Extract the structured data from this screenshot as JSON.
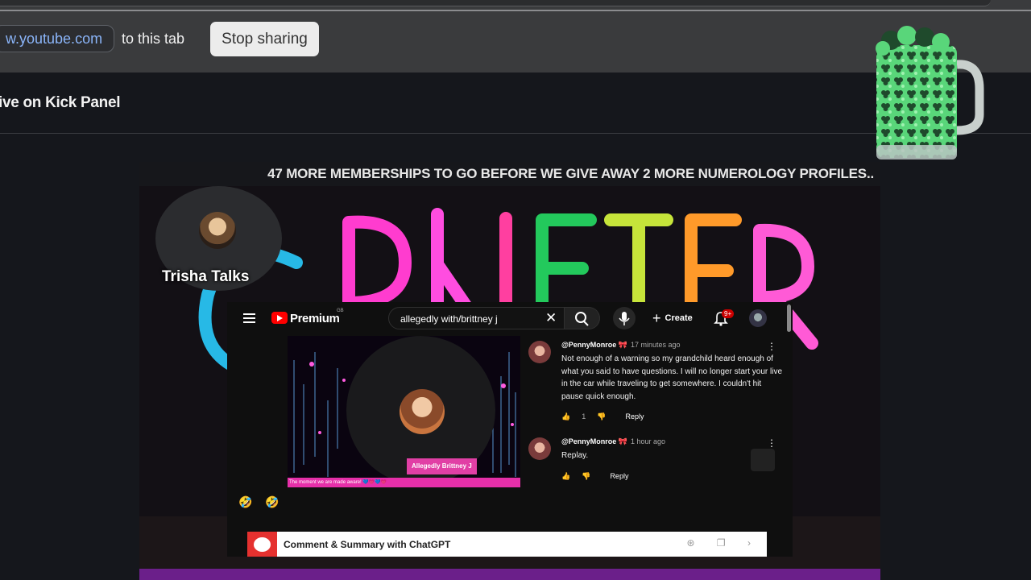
{
  "share_bar": {
    "url": "w.youtube.com",
    "sharing_text": "to this tab",
    "stop_label": "Stop sharing"
  },
  "panel": {
    "title": "ive on Kick Panel"
  },
  "stream": {
    "banner": "47 MORE MEMBERSHIPS TO GO BEFORE WE GIVE AWAY 2 MORE NUMEROLOGY PROFILES..",
    "host_name": "Trisha Talks"
  },
  "youtube": {
    "brand": "Premium",
    "country": "GB",
    "search_value": "allegedly with/brittney j",
    "create_label": "Create",
    "notification_count": "9+",
    "video": {
      "name_tag": "Allegedly Brittney J",
      "ticker": "The moment we are made aware! 💙💗💙💗"
    },
    "emojis": "🤣 🤣",
    "chatgpt_bar": "Comment & Summary with ChatGPT",
    "comments": [
      {
        "author": "@PennyMonroe",
        "time": "17 minutes ago",
        "text": "Not enough of a warning so my grandchild heard enough of what you said to have questions. I will no longer start your live in the car while traveling to get somewhere. I couldn't hit pause quick enough.",
        "likes": "1",
        "reply_label": "Reply"
      },
      {
        "author": "@PennyMonroe",
        "time": "1 hour ago",
        "text": "Replay.",
        "likes": "",
        "reply_label": "Reply"
      }
    ]
  },
  "colors": {
    "accent_link": "#8ab4f8",
    "youtube_red": "#ff0000",
    "stream_pink": "#e13fa5"
  }
}
